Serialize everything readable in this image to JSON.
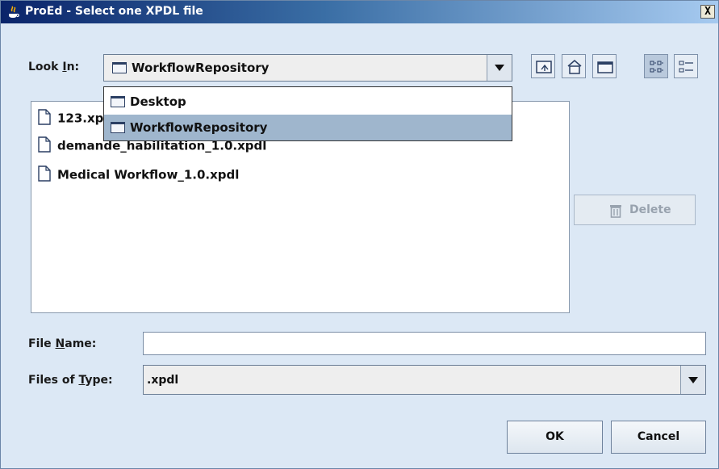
{
  "window": {
    "title": "ProEd - Select one XPDL file",
    "close_label": "X"
  },
  "look_in": {
    "label_prefix": "Look ",
    "label_mnemonic": "I",
    "label_suffix": "n:",
    "value": "WorkflowRepository"
  },
  "dropdown": {
    "options": [
      {
        "label": "Desktop",
        "selected": false
      },
      {
        "label": "WorkflowRepository",
        "selected": true
      }
    ]
  },
  "toolbar": {
    "icons": [
      "up-folder-icon",
      "home-icon",
      "new-folder-icon",
      "list-view-icon",
      "details-view-icon"
    ],
    "active": "list-view-icon"
  },
  "files": [
    {
      "name": "123.xp"
    },
    {
      "name": "demande_habilitation_1.0.xpdl"
    },
    {
      "name": "Medical Workflow_1.0.xpdl"
    }
  ],
  "delete_button": {
    "label": "Delete"
  },
  "file_name": {
    "label_prefix": "File ",
    "label_mnemonic": "N",
    "label_suffix": "ame:",
    "value": ""
  },
  "files_of_type": {
    "label_prefix": "Files of ",
    "label_mnemonic": "T",
    "label_suffix": "ype:",
    "value": ".xpdl"
  },
  "buttons": {
    "ok": "OK",
    "cancel": "Cancel"
  }
}
